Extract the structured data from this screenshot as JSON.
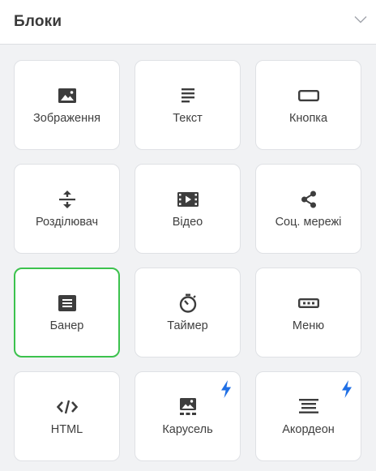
{
  "panel": {
    "title": "Блоки",
    "collapse_icon": "chevron-down-icon"
  },
  "blocks": [
    {
      "label": "Зображення",
      "icon": "image-icon",
      "premium": false,
      "selected": false
    },
    {
      "label": "Текст",
      "icon": "text-lines-icon",
      "premium": false,
      "selected": false
    },
    {
      "label": "Кнопка",
      "icon": "button-icon",
      "premium": false,
      "selected": false
    },
    {
      "label": "Розділювач",
      "icon": "divider-icon",
      "premium": false,
      "selected": false
    },
    {
      "label": "Відео",
      "icon": "video-icon",
      "premium": false,
      "selected": false
    },
    {
      "label": "Соц. мережі",
      "icon": "share-icon",
      "premium": false,
      "selected": false
    },
    {
      "label": "Банер",
      "icon": "banner-icon",
      "premium": false,
      "selected": true
    },
    {
      "label": "Таймер",
      "icon": "timer-icon",
      "premium": false,
      "selected": false
    },
    {
      "label": "Меню",
      "icon": "menu-icon",
      "premium": false,
      "selected": false
    },
    {
      "label": "HTML",
      "icon": "code-icon",
      "premium": false,
      "selected": false
    },
    {
      "label": "Карусель",
      "icon": "carousel-icon",
      "premium": true,
      "selected": false
    },
    {
      "label": "Акордеон",
      "icon": "accordion-icon",
      "premium": true,
      "selected": false
    }
  ],
  "colors": {
    "selected_border": "#3cc24d",
    "premium_bolt": "#1f6fe5",
    "icon": "#3d3d3d"
  }
}
